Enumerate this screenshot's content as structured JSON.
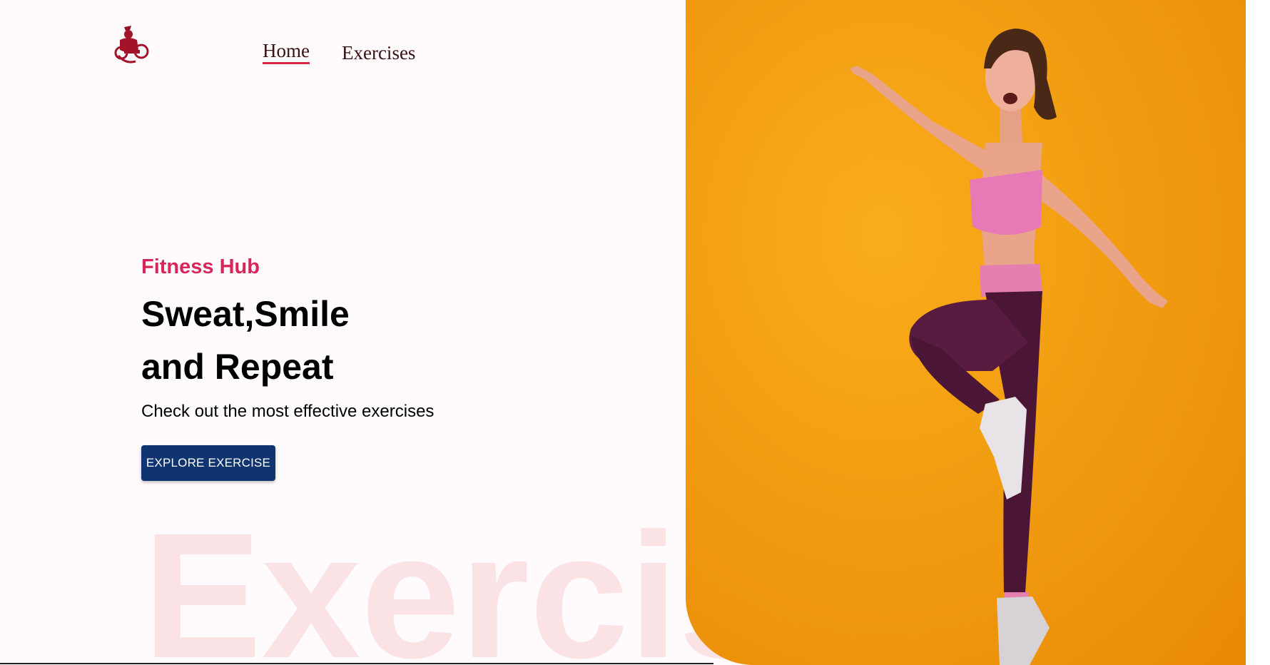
{
  "navbar": {
    "logo_icon": "bodybuilder-logo-icon",
    "links": [
      {
        "label": "Home",
        "active": true
      },
      {
        "label": "Exercises",
        "active": false
      }
    ]
  },
  "hero": {
    "tag": "Fitness Hub",
    "title_line1": "Sweat,Smile",
    "title_line2": "and Repeat",
    "subtitle": "Check out the most effective exercises",
    "cta_label": "EXPLORE EXERCISE",
    "watermark": "Exercise"
  },
  "banner": {
    "image_alt": "woman-jumping-fitness-photo",
    "background_color": "#f5a00c"
  },
  "colors": {
    "accent": "#d7265a",
    "button": "#0f3470",
    "watermark": "#fbe3e5",
    "page_background": "#fffafb"
  }
}
